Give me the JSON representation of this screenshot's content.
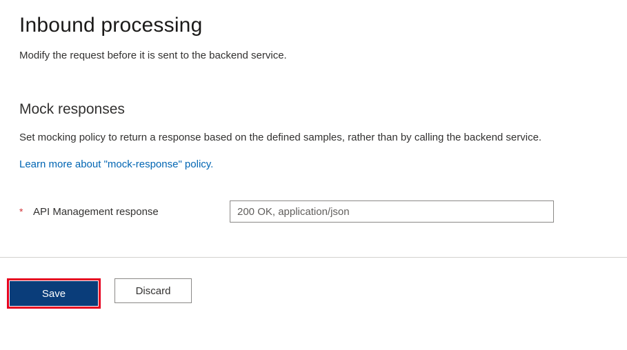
{
  "header": {
    "title": "Inbound processing",
    "description": "Modify the request before it is sent to the backend service."
  },
  "mock_responses": {
    "section_title": "Mock responses",
    "section_description": "Set mocking policy to return a response based on the defined samples, rather than by calling the backend service.",
    "learn_more_text": "Learn more about \"mock-response\" policy.",
    "field_label": "API Management response",
    "required_indicator": "*",
    "selected_value": "200 OK, application/json"
  },
  "actions": {
    "save_label": "Save",
    "discard_label": "Discard"
  },
  "colors": {
    "primary_button_bg": "#0a3d7a",
    "highlight_border": "#e6001f",
    "link_color": "#0065b3",
    "required_color": "#d13438"
  }
}
